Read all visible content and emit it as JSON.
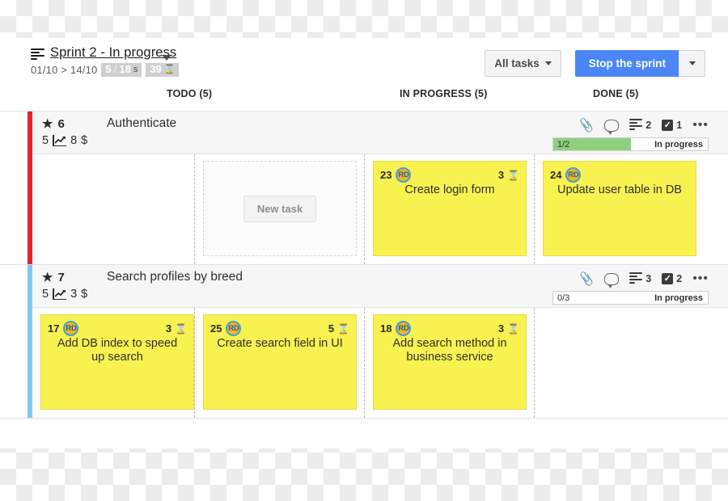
{
  "header": {
    "sprint_icon": "list-icon",
    "sprint_name": "Sprint 2 - In progress",
    "sprint_dates": "01/10 > 14/10",
    "points_badge": {
      "current": "5",
      "separator": "/",
      "total": "18",
      "unit": "s"
    },
    "time_badge": {
      "value": "39",
      "icon": "hourglass-icon"
    },
    "filter_button": "All tasks",
    "primary_button": "Stop the sprint",
    "primary_accent": "#4a86f7"
  },
  "columns": [
    {
      "id": "backlog",
      "label": ""
    },
    {
      "id": "todo",
      "label": "TODO (5)"
    },
    {
      "id": "in_progress",
      "label": "IN PROGRESS (5)"
    },
    {
      "id": "done",
      "label": "DONE (5)"
    }
  ],
  "stories": [
    {
      "accent_color": "#e3262c",
      "id": "6",
      "title": "Authenticate",
      "points": "5",
      "cost": "8",
      "currency": "$",
      "icons": {
        "attachment": "paperclip-icon",
        "comment": "speech-bubble-icon",
        "tasks_icon": "list-icon",
        "tasks_count": "2",
        "checks_icon": "checkbox-icon",
        "checks_count": "1",
        "more": "•••"
      },
      "progress": {
        "count": "1/2",
        "percent": 50,
        "status": "In progress",
        "fill_color": "#8ed07f"
      },
      "todo": {
        "type": "dropzone",
        "button": "New task"
      },
      "in_progress": [
        {
          "num": "23",
          "avatar": "RD",
          "estimate": "3",
          "estimate_icon": "hourglass-icon",
          "title": "Create login form"
        }
      ],
      "done": [
        {
          "num": "24",
          "avatar": "RD",
          "estimate": "",
          "estimate_icon": "",
          "title": "Update user table in DB"
        }
      ]
    },
    {
      "accent_color": "#7fc8f0",
      "id": "7",
      "title": "Search profiles by breed",
      "points": "5",
      "cost": "3",
      "currency": "$",
      "icons": {
        "attachment": "paperclip-icon",
        "comment": "speech-bubble-icon",
        "tasks_icon": "list-icon",
        "tasks_count": "3",
        "checks_icon": "checkbox-icon",
        "checks_count": "2",
        "more": "•••"
      },
      "progress": {
        "count": "0/3",
        "percent": 0,
        "status": "In progress",
        "fill_color": "#8ed07f"
      },
      "backlog": [
        {
          "num": "17",
          "avatar": "RD",
          "estimate": "3",
          "estimate_icon": "hourglass-icon",
          "title": "Add DB index to speed up search"
        }
      ],
      "todo": [
        {
          "num": "25",
          "avatar": "RD",
          "estimate": "5",
          "estimate_icon": "hourglass-icon",
          "title": "Create search field in UI"
        }
      ],
      "in_progress": [
        {
          "num": "18",
          "avatar": "RD",
          "estimate": "3",
          "estimate_icon": "hourglass-icon",
          "title": "Add search method in business service"
        }
      ],
      "done": []
    }
  ]
}
